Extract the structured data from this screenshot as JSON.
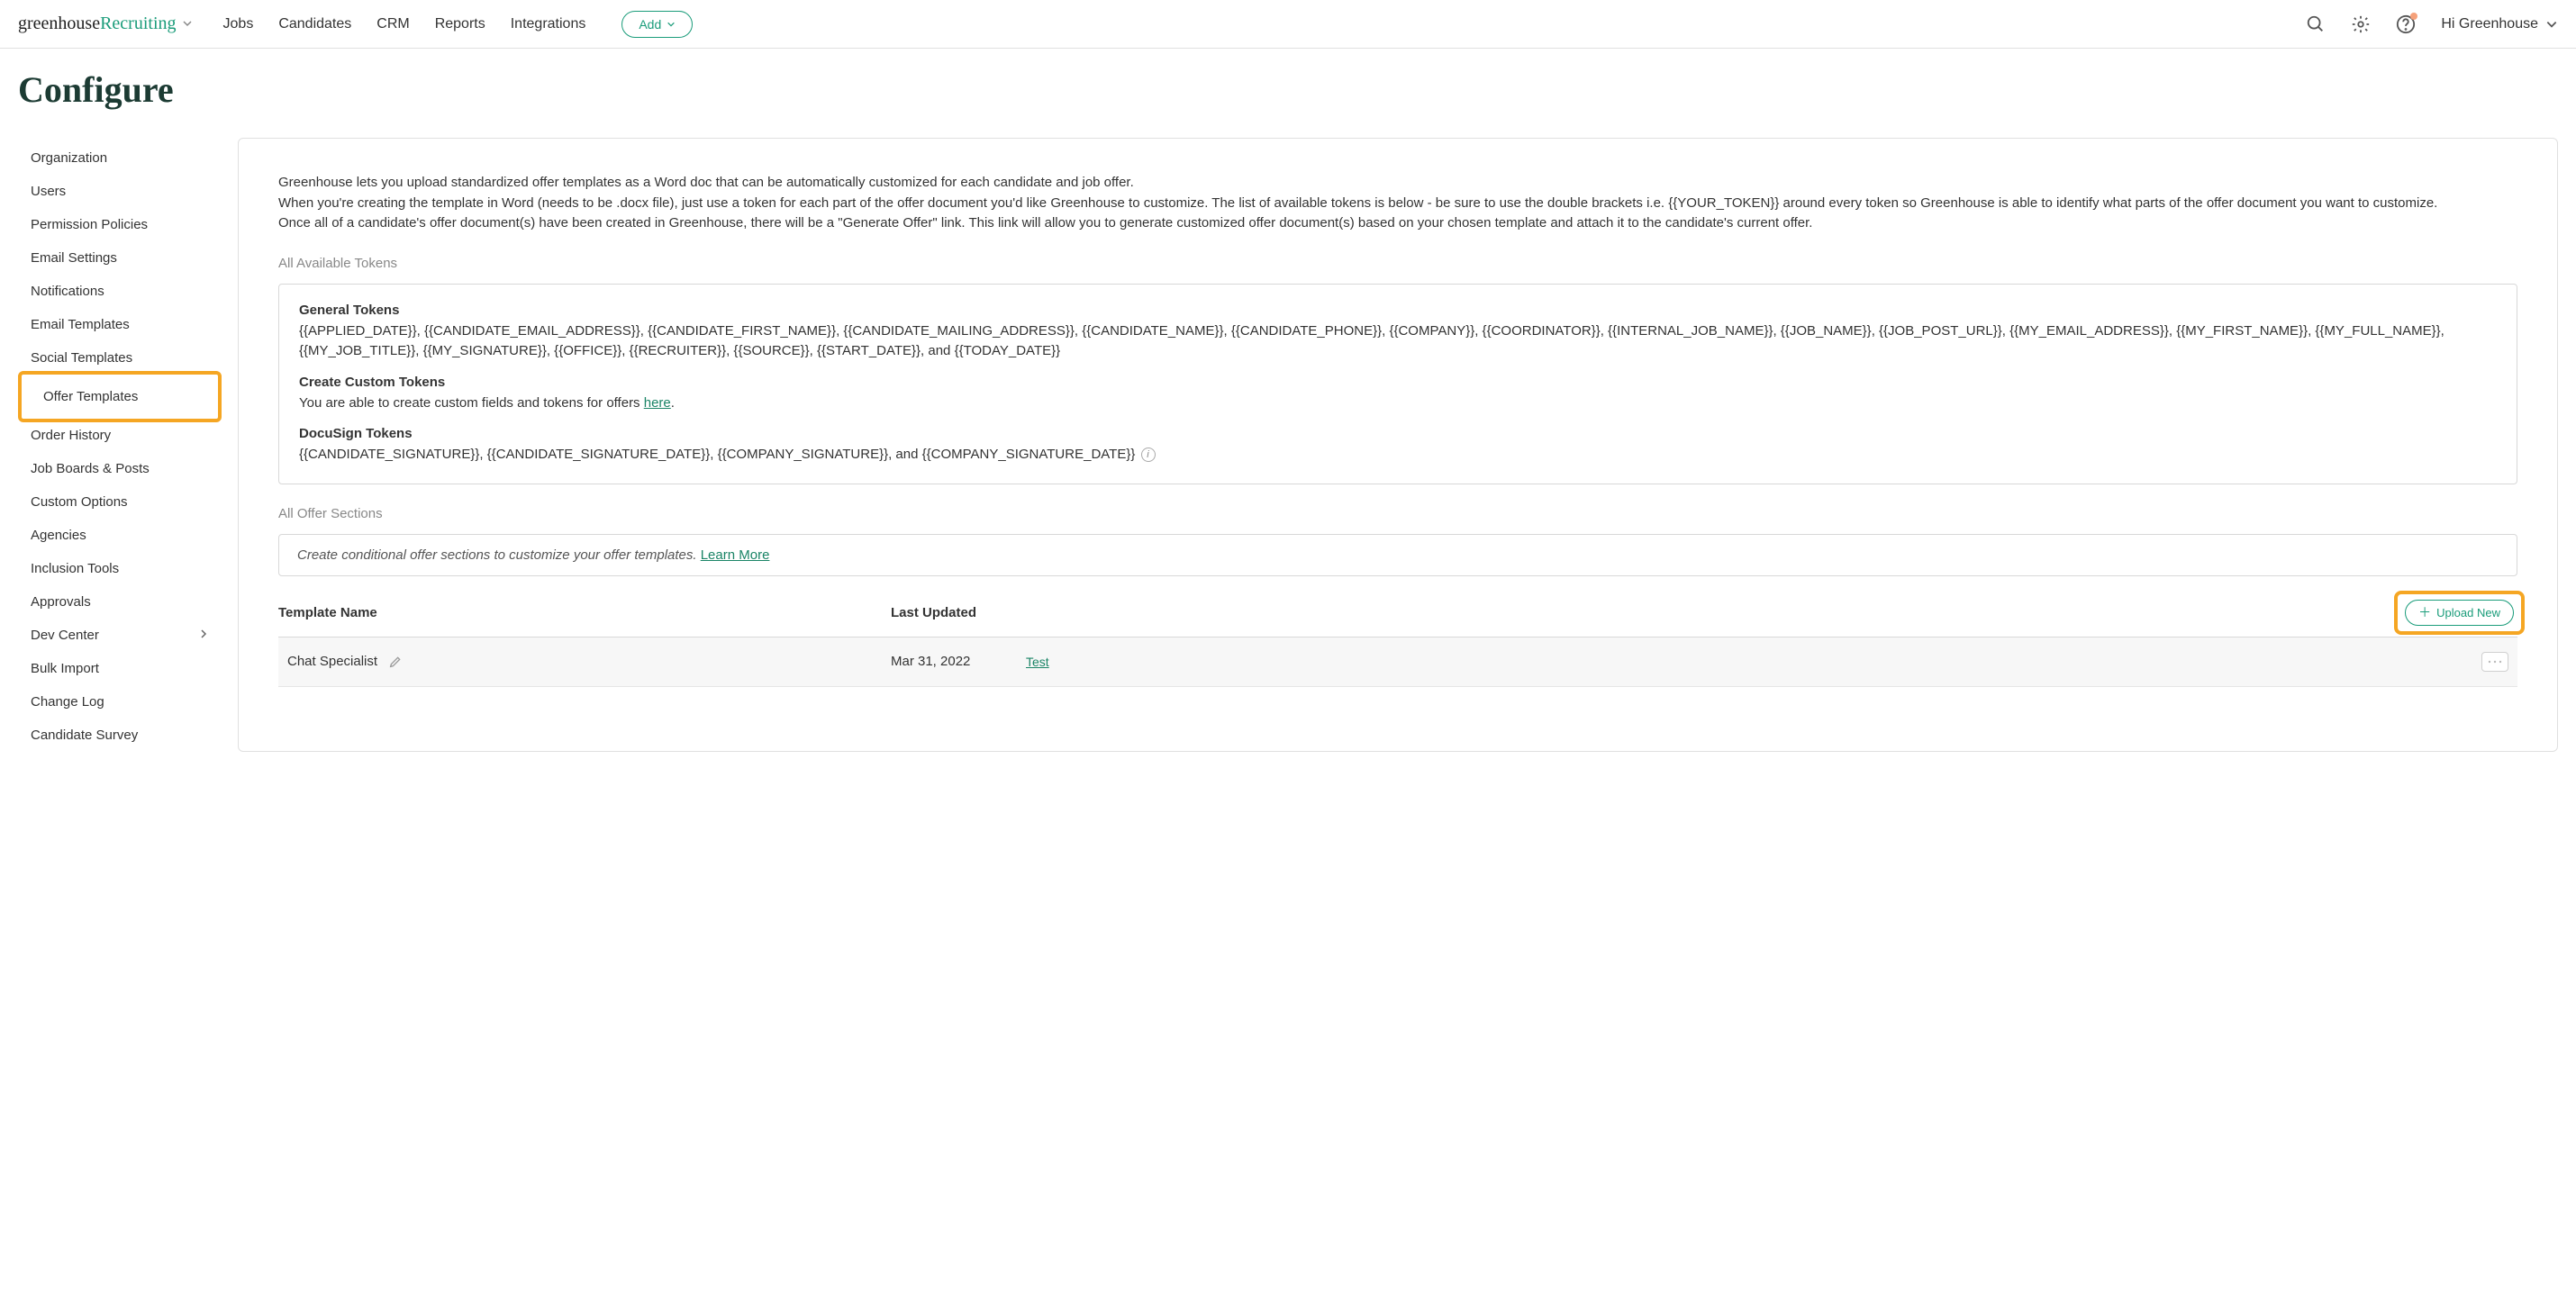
{
  "header": {
    "logo_left": "greenhouse",
    "logo_right": " Recruiting",
    "nav": [
      "Jobs",
      "Candidates",
      "CRM",
      "Reports",
      "Integrations"
    ],
    "add_label": "Add",
    "greeting": "Hi Greenhouse"
  },
  "page_title": "Configure",
  "sidebar": {
    "items": [
      "Organization",
      "Users",
      "Permission Policies",
      "Email Settings",
      "Notifications",
      "Email Templates",
      "Social Templates",
      "Offer Templates",
      "Order History",
      "Job Boards & Posts",
      "Custom Options",
      "Agencies",
      "Inclusion Tools",
      "Approvals",
      "Dev Center",
      "Bulk Import",
      "Change Log",
      "Candidate Survey"
    ],
    "active_index": 7,
    "expandable_index": 14
  },
  "intro": {
    "p1": "Greenhouse lets you upload standardized offer templates as a Word doc that can be automatically customized for each candidate and job offer.",
    "p2": "When you're creating the template in Word (needs to be .docx file), just use a token for each part of the offer document you'd like Greenhouse to customize. The list of available tokens is below - be sure to use the double brackets i.e. {{YOUR_TOKEN}} around every token so Greenhouse is able to identify what parts of the offer document you want to customize.",
    "p3": "Once all of a candidate's offer document(s) have been created in Greenhouse, there will be a \"Generate Offer\" link. This link will allow you to generate customized offer document(s) based on your chosen template and attach it to the candidate's current offer."
  },
  "tokens_section_label": "All Available Tokens",
  "tokens": {
    "general_heading": "General Tokens",
    "general_list": "{{APPLIED_DATE}}, {{CANDIDATE_EMAIL_ADDRESS}}, {{CANDIDATE_FIRST_NAME}}, {{CANDIDATE_MAILING_ADDRESS}}, {{CANDIDATE_NAME}}, {{CANDIDATE_PHONE}}, {{COMPANY}}, {{COORDINATOR}}, {{INTERNAL_JOB_NAME}}, {{JOB_NAME}}, {{JOB_POST_URL}}, {{MY_EMAIL_ADDRESS}}, {{MY_FIRST_NAME}}, {{MY_FULL_NAME}}, {{MY_JOB_TITLE}}, {{MY_SIGNATURE}}, {{OFFICE}}, {{RECRUITER}}, {{SOURCE}}, {{START_DATE}}, and {{TODAY_DATE}}",
    "custom_heading": "Create Custom Tokens",
    "custom_text": "You are able to create custom fields and tokens for offers ",
    "custom_link": "here",
    "custom_suffix": ".",
    "docusign_heading": "DocuSign Tokens",
    "docusign_list": "{{CANDIDATE_SIGNATURE}}, {{CANDIDATE_SIGNATURE_DATE}}, {{COMPANY_SIGNATURE}}, and {{COMPANY_SIGNATURE_DATE}} "
  },
  "offer_sections_label": "All Offer Sections",
  "cond_text": "Create conditional offer sections to customize your offer templates. ",
  "cond_link": "Learn More",
  "table": {
    "col_name": "Template Name",
    "col_updated": "Last Updated",
    "upload_label": "Upload New",
    "rows": [
      {
        "name": "Chat Specialist",
        "updated": "Mar 31, 2022",
        "by": "Test"
      }
    ]
  }
}
